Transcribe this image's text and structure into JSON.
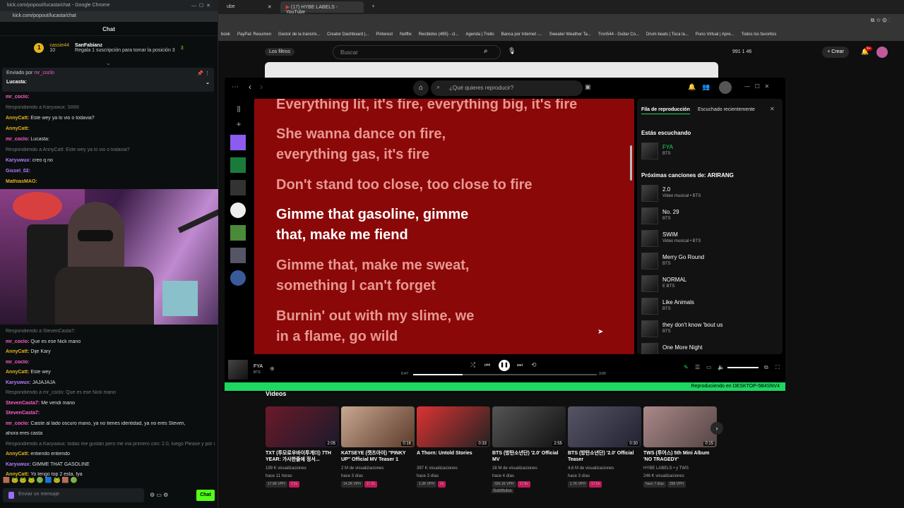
{
  "kick": {
    "window_title": "kick.com/popout/lucasta/chat - Google Chrome",
    "url": "kick.com/popout/lucasta/chat",
    "chat_title": "Chat",
    "leader1_name": "cassie44",
    "leader1_count": "10",
    "leader2_name": "SanFabianz",
    "leader2_count": "3",
    "leader_hint": "Regala 1 suscripción para tomar la posición 3",
    "pinned_by": "Enviado por",
    "pinned_user": "mr_coclo",
    "pinned_text": "Lucasta:",
    "lines_top": [
      {
        "user": "mr_coclo:",
        "text": "",
        "reply": ""
      },
      {
        "user": "",
        "text": "",
        "reply": "Respondiendo a Karyuwux: SIIIIII"
      },
      {
        "user": "AnnyCatt:",
        "text": "Este wey ya lo vio o todavia?",
        "reply": ""
      },
      {
        "user": "AnnyCatt:",
        "text": "",
        "reply": ""
      },
      {
        "user": "mr_coclo:",
        "text": "Lucasta:",
        "reply": ""
      },
      {
        "user": "",
        "text": "",
        "reply": "Respondiendo a AnnyCatt: Este wey ya lo vio o todavia?"
      },
      {
        "user": "Karyuwux:",
        "text": "creo q no",
        "reply": ""
      },
      {
        "user": "Gissel_02:",
        "text": "",
        "reply": ""
      },
      {
        "user": "MathiasMAO:",
        "text": "",
        "reply": ""
      },
      {
        "user": "MathiasMAO:",
        "text": "",
        "reply": ""
      }
    ],
    "lines_bottom": [
      {
        "user": "",
        "text": "",
        "reply": "Respondiendo a StevenCasta7:"
      },
      {
        "user": "mr_coclo:",
        "text": "Que es ese Nick mano",
        "reply": ""
      },
      {
        "user": "AnnyCatt:",
        "text": "Dije Kary",
        "reply": ""
      },
      {
        "user": "mr_coclo:",
        "text": "",
        "reply": ""
      },
      {
        "user": "AnnyCatt:",
        "text": "Este wey",
        "reply": ""
      },
      {
        "user": "Karyuwux:",
        "text": "JAJAJAJA",
        "reply": ""
      },
      {
        "user": "",
        "text": "",
        "reply": "Respondiendo a mr_coclo: Que es ese Nick mano"
      },
      {
        "user": "StevenCasta7:",
        "text": "Me vendi mano",
        "reply": ""
      },
      {
        "user": "StevenCasta7:",
        "text": "",
        "reply": ""
      },
      {
        "user": "mr_coclo:",
        "text": "Caiste al lado oscuro mano, ya no tienes identidad, ya no eres Steven,",
        "reply": ""
      },
      {
        "user": "",
        "text": "ahora eres casta",
        "reply": ""
      },
      {
        "user": "",
        "text": "",
        "reply": "Respondiendo a Karyuwux: todas me gustan pero me iria primero con: 2.0, luego Please y por ul..."
      },
      {
        "user": "AnnyCatt:",
        "text": "entiendo entiendo",
        "reply": ""
      },
      {
        "user": "Karyuwux:",
        "text": "GIMME THAT GASOLINE",
        "reply": ""
      },
      {
        "user": "AnnyCatt:",
        "text": "Yo tengo top 2 esta, fya",
        "reply": ""
      }
    ],
    "input_placeholder": "Enviar un mensaje",
    "send_label": "Chat"
  },
  "browser": {
    "tabs": [
      "ube",
      "(17) HYBE LABELS - YouTube"
    ],
    "bookmarks": [
      "book",
      "PayPal: Resumen",
      "Gestor de la transmi...",
      "Creator Dashboard |...",
      "Pinterest",
      "Netflix",
      "Recibidos (495) - cl...",
      "Agenda | Trello",
      "Banca por Internet -...",
      "Sweater Weather Ta...",
      "Tron544 - Guitar Co...",
      "Drum beats | Toca la...",
      "Puno Virtual | Apre...",
      "Todos los favoritos"
    ],
    "filters_label": "Los filtros",
    "search_placeholder": "Buscar",
    "stats": "991  1  46",
    "create_label": "Crear",
    "notif_count": "9+"
  },
  "spotify": {
    "search_placeholder": "¿Qué quieres reproducir?",
    "lyrics": [
      {
        "text": "Everything lit, it's fire, everything big, it's fire",
        "state": "dim"
      },
      {
        "text": "She wanna dance on fire, everything gas, it's fire",
        "state": "dim"
      },
      {
        "text": "Don't stand too close, too close to fire",
        "state": "dim"
      },
      {
        "text": "Gimme that gasoline, gimme that, make me fiend",
        "state": "bright"
      },
      {
        "text": "Gimme that, make me sweat, something I can't forget",
        "state": "dim"
      },
      {
        "text": "Burnin' out with my slime, we in a flame, go wild",
        "state": "dim"
      }
    ],
    "queue_tab": "Fila de reproducción",
    "recent_tab": "Escuchado recientemente",
    "now_playing_header": "Estás escuchando",
    "now_title": "FYA",
    "now_artist": "BTS",
    "next_header": "Próximas canciones de: ARIRANG",
    "queue": [
      {
        "title": "2.0",
        "sub": "Video musical • BTS"
      },
      {
        "title": "No. 29",
        "sub": "BTS"
      },
      {
        "title": "SWIM",
        "sub": "Video musical • BTS"
      },
      {
        "title": "Merry Go Round",
        "sub": "BTS"
      },
      {
        "title": "NORMAL",
        "sub": "E BTS"
      },
      {
        "title": "Like Animals",
        "sub": "BTS"
      },
      {
        "title": "they don't know 'bout us",
        "sub": "BTS"
      },
      {
        "title": "One More Night",
        "sub": ""
      }
    ],
    "player_title": "FYA",
    "player_artist": "BTS",
    "time_current": "0:47",
    "time_total": "3:00",
    "progress": 0.27,
    "device": "Reproduciendo en DESKTOP-5B4SNV4"
  },
  "youtube": {
    "videos_title": "Videos",
    "videos": [
      {
        "title": "TXT (투모로우바이투게더) 7TH YEAR: 가사한줄에 정서...",
        "meta": "199 K visualizaciones",
        "age": "hace 11 horas",
        "dur": "2:05",
        "chips": [
          "17.6K VPH",
          "1.5x"
        ]
      },
      {
        "title": "KATSEYE (캣츠아이) \"PINKY UP\" Official MV Teaser 1",
        "meta": "2 M de visualizaciones",
        "age": "hace 3 días",
        "dur": "0:16",
        "chips": [
          "14.2K VPH",
          "17.3x"
        ]
      },
      {
        "title": "A Thorn: Untold Stories",
        "meta": "397 K visualizaciones",
        "age": "hace 3 días",
        "dur": "0:33",
        "chips": [
          "1.3K VPH",
          "2x"
        ]
      },
      {
        "title": "BTS (방탄소년단) '2.0' Official MV",
        "meta": "28 M de visualizaciones",
        "age": "hace 4 días",
        "dur": "2:55",
        "chips": [
          "326.1K VPH",
          "17.8x"
        ]
      },
      {
        "title": "BTS (방탄소년단) '2.0' Official Teaser",
        "meta": "4,6 M de visualizaciones",
        "age": "hace 3 días",
        "dur": "0:30",
        "chips": [
          "1.7K VPH",
          "17.9x"
        ]
      },
      {
        "title": "TWS (투어스) 5th Mini Album 'NO TRAGEDY'",
        "meta": "HYBE LABELS • y TWS",
        "age": "246 K visualizaciones",
        "dur": "0:15",
        "chips": [
          "hace 7 días",
          "258 VPH"
        ]
      }
    ],
    "subtitles_label": "Subtítulos"
  }
}
